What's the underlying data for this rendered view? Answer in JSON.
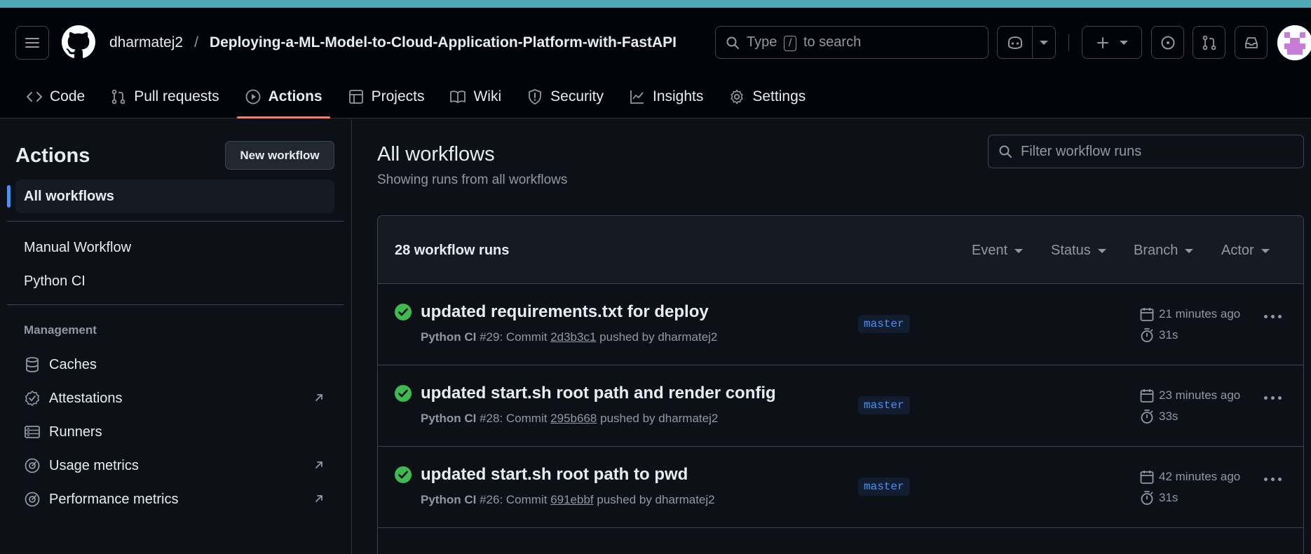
{
  "header": {
    "owner": "dharmatej2",
    "separator": "/",
    "repo": "Deploying-a-ML-Model-to-Cloud-Application-Platform-with-FastAPI",
    "search_prefix": "Type",
    "search_key": "/",
    "search_suffix": "to search"
  },
  "tabs": [
    {
      "label": "Code",
      "icon": "code-icon"
    },
    {
      "label": "Pull requests",
      "icon": "git-pull-request-icon"
    },
    {
      "label": "Actions",
      "icon": "play-icon",
      "active": true
    },
    {
      "label": "Projects",
      "icon": "table-icon"
    },
    {
      "label": "Wiki",
      "icon": "book-icon"
    },
    {
      "label": "Security",
      "icon": "shield-icon"
    },
    {
      "label": "Insights",
      "icon": "graph-icon"
    },
    {
      "label": "Settings",
      "icon": "gear-icon"
    }
  ],
  "sidebar": {
    "title": "Actions",
    "new_workflow": "New workflow",
    "all_workflows": "All workflows",
    "workflows": [
      "Manual Workflow",
      "Python CI"
    ],
    "management_heading": "Management",
    "management": [
      {
        "label": "Caches",
        "icon": "database-icon"
      },
      {
        "label": "Attestations",
        "icon": "verified-icon",
        "external": true
      },
      {
        "label": "Runners",
        "icon": "server-icon"
      },
      {
        "label": "Usage metrics",
        "icon": "meter-icon",
        "external": true
      },
      {
        "label": "Performance metrics",
        "icon": "meter-icon",
        "external": true
      }
    ]
  },
  "main": {
    "title": "All workflows",
    "subtitle": "Showing runs from all workflows",
    "filter_placeholder": "Filter workflow runs",
    "runs_count": "28 workflow runs",
    "filters": [
      "Event",
      "Status",
      "Branch",
      "Actor"
    ],
    "runs": [
      {
        "title": "updated requirements.txt for deploy",
        "workflow": "Python CI",
        "number": "#29: Commit",
        "sha": "2d3b3c1",
        "pushed_by": "pushed by dharmatej2",
        "branch": "master",
        "when": "21 minutes ago",
        "duration": "31s"
      },
      {
        "title": "updated start.sh root path and render config",
        "workflow": "Python CI",
        "number": "#28: Commit",
        "sha": "295b668",
        "pushed_by": "pushed by dharmatej2",
        "branch": "master",
        "when": "23 minutes ago",
        "duration": "33s"
      },
      {
        "title": "updated start.sh root path to pwd",
        "workflow": "Python CI",
        "number": "#26: Commit",
        "sha": "691ebbf",
        "pushed_by": "pushed by dharmatej2",
        "branch": "master",
        "when": "42 minutes ago",
        "duration": "31s"
      }
    ]
  },
  "colors": {
    "accent": "#f78166",
    "success": "#3fb950",
    "link": "#4493f8"
  }
}
